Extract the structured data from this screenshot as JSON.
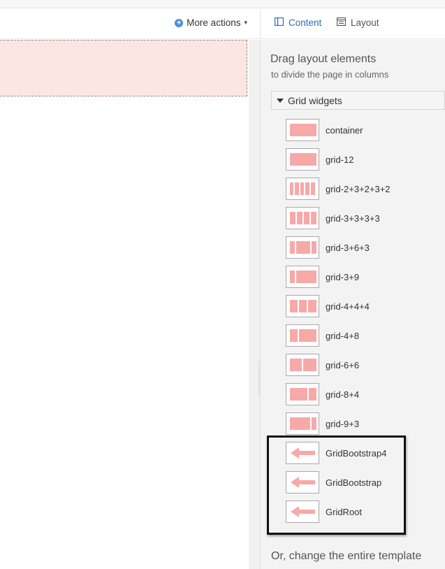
{
  "toolbar": {
    "more_actions_label": "More actions",
    "plus_glyph": "+",
    "caret_glyph": "▾"
  },
  "panel": {
    "tabs": [
      {
        "label": "Content",
        "icon": "columns-icon",
        "active": true
      },
      {
        "label": "Layout",
        "icon": "layout-icon",
        "active": false
      }
    ],
    "title": "Drag layout elements",
    "subtitle": "to divide the page in columns",
    "group": {
      "label": "Grid widgets",
      "items": [
        {
          "label": "container",
          "icon": "grid-container-icon"
        },
        {
          "label": "grid-12",
          "icon": "grid-12-icon"
        },
        {
          "label": "grid-2+3+2+3+2",
          "icon": "grid-2-3-2-3-2-icon"
        },
        {
          "label": "grid-3+3+3+3",
          "icon": "grid-3-3-3-3-icon"
        },
        {
          "label": "grid-3+6+3",
          "icon": "grid-3-6-3-icon"
        },
        {
          "label": "grid-3+9",
          "icon": "grid-3-9-icon"
        },
        {
          "label": "grid-4+4+4",
          "icon": "grid-4-4-4-icon"
        },
        {
          "label": "grid-4+8",
          "icon": "grid-4-8-icon"
        },
        {
          "label": "grid-6+6",
          "icon": "grid-6-6-icon"
        },
        {
          "label": "grid-8+4",
          "icon": "grid-8-4-icon"
        },
        {
          "label": "grid-9+3",
          "icon": "grid-9-3-icon"
        },
        {
          "label": "GridBootstrap4",
          "icon": "arrow-left-icon"
        },
        {
          "label": "GridBootstrap",
          "icon": "arrow-left-icon"
        },
        {
          "label": "GridRoot",
          "icon": "arrow-left-icon"
        }
      ]
    },
    "footer": "Or, change the entire template"
  },
  "colors": {
    "accent": "#2b6cb8",
    "widget_fill": "#f7a9a8",
    "drop_zone": "#fde5e4"
  }
}
